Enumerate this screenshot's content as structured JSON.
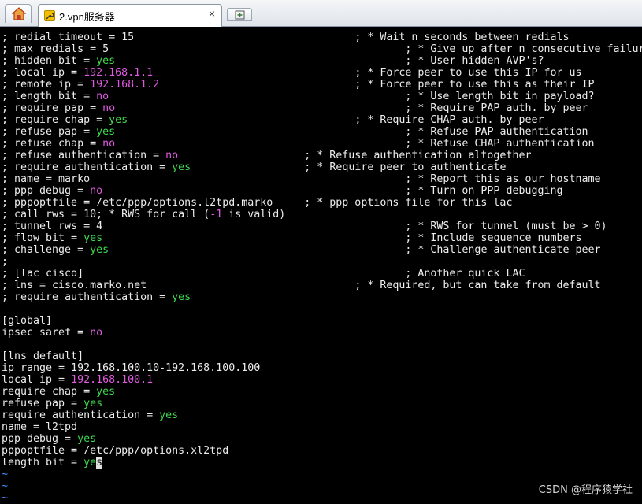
{
  "window": {
    "tab_title": "2.vpn服务器",
    "tab_close_glyph": "×",
    "home_icon": "home-icon",
    "tab_icon": "wrench-icon",
    "new_tab_icon": "new-tab-icon"
  },
  "colors": {
    "text": "#ececec",
    "green": "#3fd94f",
    "pink": "#e05ae0",
    "tilde": "#4a90ff",
    "background": "#000000"
  },
  "lines": [
    [
      {
        "t": "; redial timeout = 15"
      },
      {
        "t": "; * Wait n seconds between redials",
        "c": 448
      }
    ],
    [
      {
        "t": "; max redials = 5"
      },
      {
        "t": "; * Give up after n consecutive failur",
        "c": 512
      }
    ],
    [
      {
        "t": "; hidden bit = "
      },
      {
        "t": "yes",
        "k": "g"
      },
      {
        "t": "; * User hidden AVP's?",
        "c": 512
      }
    ],
    [
      {
        "t": "; local ip = "
      },
      {
        "t": "192.168.1.1",
        "k": "p"
      },
      {
        "t": "; * Force peer to use this IP for us",
        "c": 448
      }
    ],
    [
      {
        "t": "; remote ip = "
      },
      {
        "t": "192.168.1.2",
        "k": "p"
      },
      {
        "t": "; * Force peer to use this as their IP",
        "c": 448
      }
    ],
    [
      {
        "t": "; length bit = "
      },
      {
        "t": "no",
        "k": "p"
      },
      {
        "t": "; * Use length bit in payload?",
        "c": 512
      }
    ],
    [
      {
        "t": "; require pap = "
      },
      {
        "t": "no",
        "k": "p"
      },
      {
        "t": "; * Require PAP auth. by peer",
        "c": 512
      }
    ],
    [
      {
        "t": "; require chap = "
      },
      {
        "t": "yes",
        "k": "g"
      },
      {
        "t": "; * Require CHAP auth. by peer",
        "c": 448
      }
    ],
    [
      {
        "t": "; refuse pap = "
      },
      {
        "t": "yes",
        "k": "g"
      },
      {
        "t": "; * Refuse PAP authentication",
        "c": 512
      }
    ],
    [
      {
        "t": "; refuse chap = "
      },
      {
        "t": "no",
        "k": "p"
      },
      {
        "t": "; * Refuse CHAP authentication",
        "c": 512
      }
    ],
    [
      {
        "t": "; refuse authentication = "
      },
      {
        "t": "no",
        "k": "p"
      },
      {
        "t": "; * Refuse authentication altogether",
        "c": 384
      }
    ],
    [
      {
        "t": "; require authentication = "
      },
      {
        "t": "yes",
        "k": "g"
      },
      {
        "t": "; * Require peer to authenticate",
        "c": 384
      }
    ],
    [
      {
        "t": "; name = marko"
      },
      {
        "t": "; * Report this as our hostname",
        "c": 512
      }
    ],
    [
      {
        "t": "; ppp debug = "
      },
      {
        "t": "no",
        "k": "p"
      },
      {
        "t": "; * Turn on PPP debugging",
        "c": 512
      }
    ],
    [
      {
        "t": "; pppoptfile = /etc/ppp/options.l2tpd.marko"
      },
      {
        "t": "; * ppp options file for this lac",
        "c": 384
      }
    ],
    [
      {
        "t": "; call rws = 10"
      },
      {
        "t": "; * RWS for call ("
      },
      {
        "t": "-1",
        "k": "p"
      },
      {
        "t": " is valid)"
      }
    ],
    [
      {
        "t": "; tunnel rws = 4"
      },
      {
        "t": "; * RWS for tunnel (must be > 0)",
        "c": 512
      }
    ],
    [
      {
        "t": "; flow bit = "
      },
      {
        "t": "yes",
        "k": "g"
      },
      {
        "t": "; * Include sequence numbers",
        "c": 512
      }
    ],
    [
      {
        "t": "; challenge = "
      },
      {
        "t": "yes",
        "k": "g"
      },
      {
        "t": "; * Challenge authenticate peer",
        "c": 512
      }
    ],
    [
      {
        "t": ";"
      }
    ],
    [
      {
        "t": "; [lac cisco]"
      },
      {
        "t": "; Another quick LAC",
        "c": 512
      }
    ],
    [
      {
        "t": "; lns = cisco.marko.net"
      },
      {
        "t": "; * Required, but can take from default",
        "c": 448
      }
    ],
    [
      {
        "t": "; require authentication = "
      },
      {
        "t": "yes",
        "k": "g"
      }
    ],
    [],
    [
      {
        "t": "[global]"
      }
    ],
    [
      {
        "t": "ipsec saref = "
      },
      {
        "t": "no",
        "k": "p"
      }
    ],
    [],
    [
      {
        "t": "[lns default]"
      }
    ],
    [
      {
        "t": "ip range = 192.168.100.10-192.168.100.100"
      }
    ],
    [
      {
        "t": "local ip = "
      },
      {
        "t": "192.168.100.1",
        "k": "p"
      }
    ],
    [
      {
        "t": "require chap = "
      },
      {
        "t": "yes",
        "k": "g"
      }
    ],
    [
      {
        "t": "refuse pap = "
      },
      {
        "t": "yes",
        "k": "g"
      }
    ],
    [
      {
        "t": "require authentication = "
      },
      {
        "t": "yes",
        "k": "g"
      }
    ],
    [
      {
        "t": "name = l2tpd"
      }
    ],
    [
      {
        "t": "ppp debug = "
      },
      {
        "t": "yes",
        "k": "g"
      }
    ],
    [
      {
        "t": "pppoptfile = /etc/ppp/options.xl2tpd"
      }
    ],
    [
      {
        "t": "length bit = "
      },
      {
        "t": "ye",
        "k": "g"
      },
      {
        "t": "s",
        "k": "cur"
      }
    ],
    [
      {
        "t": "~",
        "k": "tilde"
      }
    ],
    [
      {
        "t": "~",
        "k": "tilde"
      }
    ],
    [
      {
        "t": "~",
        "k": "tilde"
      }
    ]
  ],
  "watermark": "CSDN @程序猿学社"
}
